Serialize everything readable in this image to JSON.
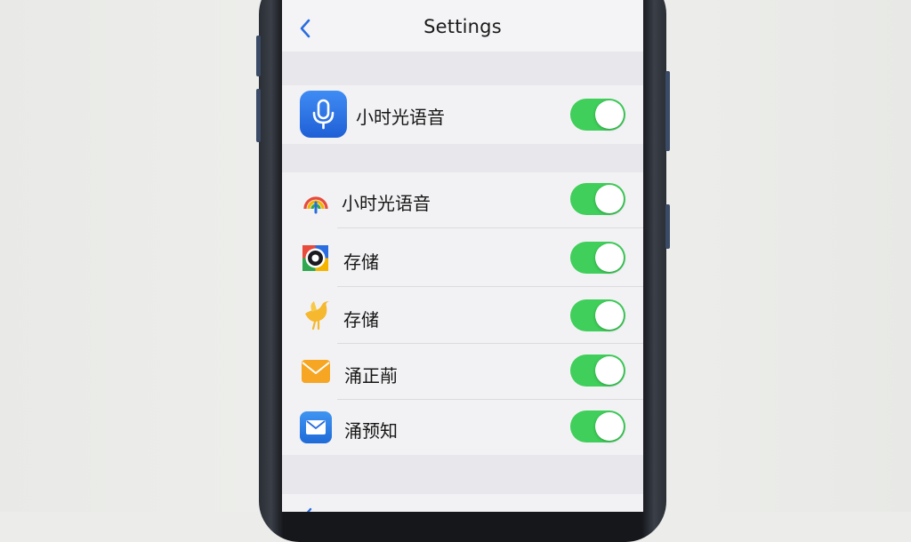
{
  "nav": {
    "title": "Settings",
    "back_icon": "chevron-left-icon"
  },
  "featured": {
    "label": "小时光语音",
    "icon": "microphone-icon",
    "toggle_on": true
  },
  "items": [
    {
      "label": "小时光语音",
      "icon": "rainbow-icon",
      "toggle_on": true
    },
    {
      "label": "存储",
      "icon": "camera-lens-icon",
      "toggle_on": true
    },
    {
      "label": "存储",
      "icon": "bird-icon",
      "toggle_on": true
    },
    {
      "label": "涌正萷",
      "icon": "mail-envelope-icon",
      "toggle_on": true
    },
    {
      "label": "涌预知",
      "icon": "message-envelope-icon",
      "toggle_on": true
    }
  ],
  "colors": {
    "toggle_on": "#3fcf5a",
    "accent_blue": "#2a6de0",
    "screen_bg": "#efeff2"
  }
}
